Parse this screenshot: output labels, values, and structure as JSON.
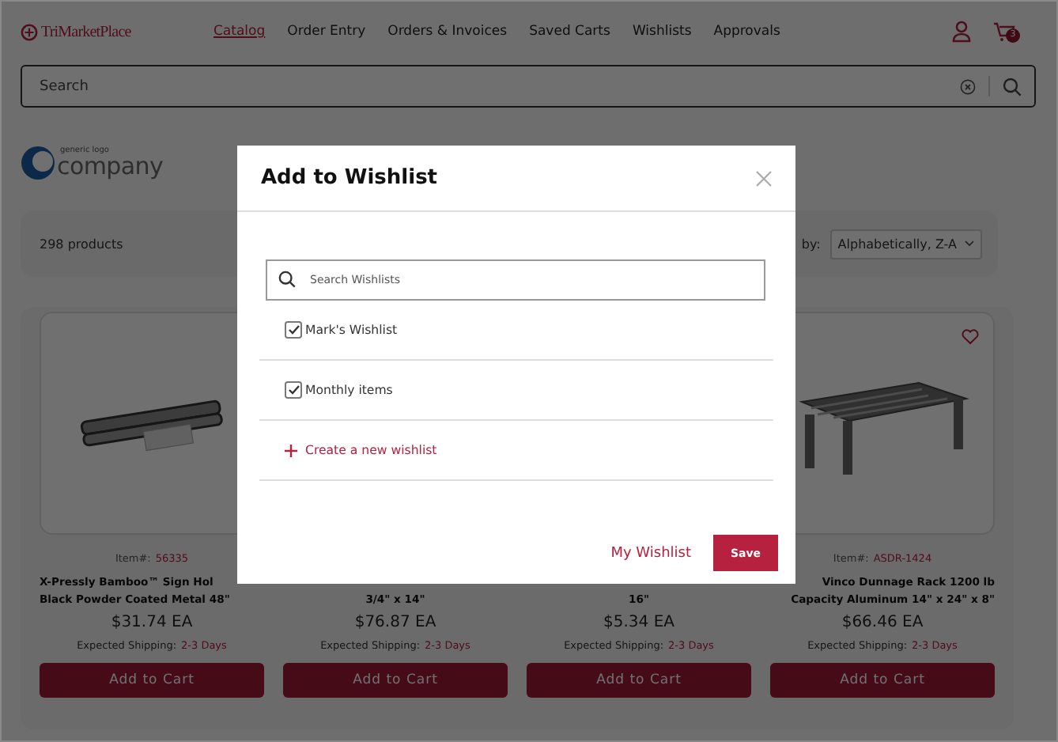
{
  "header": {
    "logo": "TriMarketPlace",
    "nav": [
      {
        "label": "Catalog",
        "selected": true
      },
      {
        "label": "Order Entry",
        "selected": false
      },
      {
        "label": "Orders & Invoices",
        "selected": false
      },
      {
        "label": "Saved Carts",
        "selected": false
      },
      {
        "label": "Wishlists",
        "selected": false
      },
      {
        "label": "Approvals",
        "selected": false
      }
    ],
    "cart_count": "3"
  },
  "search": {
    "placeholder": "Search"
  },
  "brand_logo": {
    "small": "generic logo",
    "large": "company"
  },
  "toolbar": {
    "count": "298 products",
    "sort_label": "by:",
    "sort_value": "Alphabetically, Z-A"
  },
  "products": [
    {
      "kind": "sign-holder",
      "item_label": "Item#:",
      "item_no": "56335",
      "title": [
        "X-Pressly Bamboo™ Sign Hol",
        "Black Powder Coated Metal 48\""
      ],
      "price": "$31.74 EA",
      "shipping_label": "Expected Shipping:",
      "shipping_value": "2-3 Days",
      "button": "Add to Cart"
    },
    {
      "title": [
        "3/4\" x 14\""
      ],
      "price": "$76.87 EA",
      "shipping_label": "Expected Shipping:",
      "shipping_value": "2-3 Days",
      "button": "Add to Cart"
    },
    {
      "title": [
        "16\""
      ],
      "price": "$5.34 EA",
      "shipping_label": "Expected Shipping:",
      "shipping_value": "2-3 Days",
      "button": "Add to Cart"
    },
    {
      "kind": "rack",
      "favorite": false,
      "item_label": "Item#:",
      "item_no": "ASDR-1424",
      "title": [
        "Vinco Dunnage Rack 1200 lb",
        "Capacity Aluminum 14\" x 24\" x 8\""
      ],
      "price": "$66.46 EA",
      "shipping_label": "Expected Shipping:",
      "shipping_value": "2-3 Days",
      "button": "Add to Cart"
    }
  ],
  "modal": {
    "title": "Add to Wishlist",
    "search_placeholder": "Search Wishlists",
    "wishlists": [
      {
        "name": "Mark's Wishlist",
        "checked": true
      },
      {
        "name": "Monthly items",
        "checked": true
      }
    ],
    "create": "Create a new wishlist",
    "link": "My Wishlist",
    "save": "Save"
  }
}
